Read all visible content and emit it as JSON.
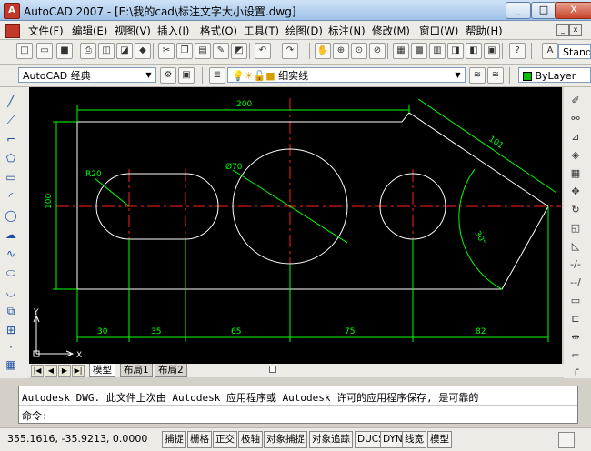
{
  "window": {
    "title": "AutoCAD 2007 - [E:\\我的cad\\标注文字大小设置.dwg]",
    "minimize": "_",
    "maximize": "□",
    "close": "X"
  },
  "menu": [
    "文件(F)",
    "编辑(E)",
    "视图(V)",
    "插入(I)",
    "格式(O)",
    "工具(T)",
    "绘图(D)",
    "标注(N)",
    "修改(M)",
    "窗口(W)",
    "帮助(H)"
  ],
  "toolbar": {
    "workspace": "AutoCAD 经典",
    "layer": "细实线",
    "text_style": "Stand",
    "color": "ByLayer"
  },
  "drawing": {
    "dimensions": {
      "top_width": "200",
      "height": "100",
      "slant": "101",
      "r_slot": "R20",
      "dia_circle": "Ø70",
      "angle": "30°",
      "bottom": [
        "30",
        "35",
        "65",
        "75",
        "82"
      ]
    },
    "axis": {
      "y": "Y",
      "x": "X"
    }
  },
  "tabs": {
    "model": "模型",
    "layout1": "布局1",
    "layout2": "布局2"
  },
  "command": {
    "line1": "Autodesk DWG.  此文件上次由 Autodesk 应用程序或 Autodesk 许可的应用程序保存, 是可靠的",
    "prompt": "命令:"
  },
  "status": {
    "coords": "355.1616, -35.9213, 0.0000",
    "buttons": [
      "捕捉",
      "栅格",
      "正交",
      "极轴",
      "对象捕捉",
      "对象追踪",
      "DUCS",
      "DYN",
      "线宽",
      "模型"
    ]
  },
  "colors": {
    "canvas": "#000000",
    "geometry": "#ffffff",
    "centerline": "#ff2020",
    "dimension": "#00ff00"
  }
}
